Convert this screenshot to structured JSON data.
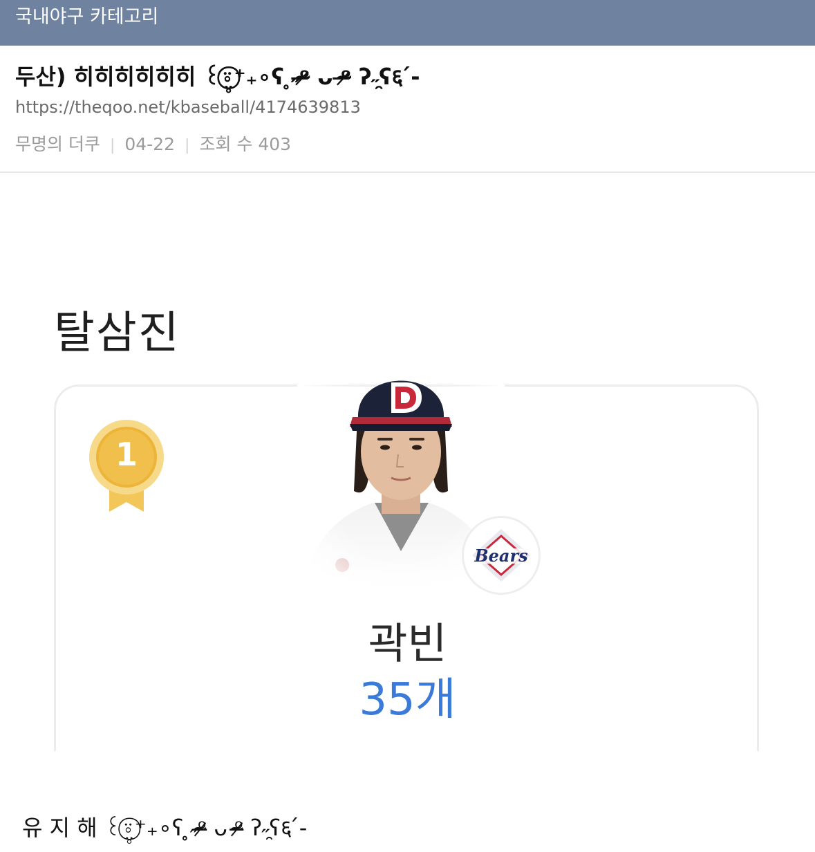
{
  "category": {
    "label": "국내야구 카테고리"
  },
  "post": {
    "title": "두산) 히히히히히히 ꒰⍤⃝̤̥⁺₊∘ʕ ̥˶ᵒ̴̶̷ ᴗ ᵒ̴̶̷ ʔ˶̯ʕ६ ́-",
    "url": "https://theqoo.net/kbaseball/4174639813",
    "author": "무명의 더쿠",
    "date": "04-22",
    "views_label": "조회 수 403"
  },
  "ranking": {
    "title": "탈삼진",
    "rank": "1",
    "player_name": "곽빈",
    "stat_value": "35개",
    "team_logo_text": "Bears",
    "accent_color": "#3a7ad8",
    "medal_color": "#f0c04a"
  },
  "comment": {
    "text": "유 지 해 ꒰⍤⃝̤̥⁺₊∘ʕ ̥˶ᵒ̴̶̷ ᴗ ᵒ̴̶̷ ʔ˶̯ʕ६ ́-"
  },
  "colors": {
    "category_bar": "#6f829f",
    "divider": "#e6e6e6"
  }
}
